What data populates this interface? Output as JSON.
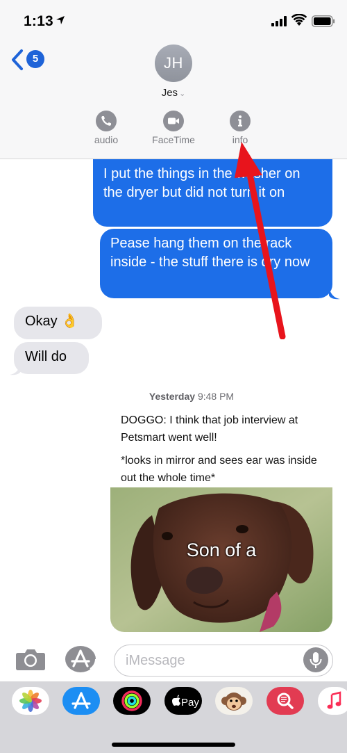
{
  "status_bar": {
    "time": "1:13"
  },
  "header": {
    "back_count": "5",
    "avatar_initials": "JH",
    "contact_name": "Jes",
    "chevron": "⌄",
    "actions": [
      {
        "label": "audio",
        "icon": "phone-icon"
      },
      {
        "label": "FaceTime",
        "icon": "video-camera-icon"
      },
      {
        "label": "info",
        "icon": "info-icon"
      }
    ]
  },
  "messages": {
    "sent": [
      "I put the things in the washer on the dryer but did not turn it on",
      "Pease hang them on the rack inside - the stuff there is dry now"
    ],
    "received": [
      "Okay 👌",
      "Will do"
    ]
  },
  "shared": {
    "day": "Yesterday",
    "time": "9:48 PM",
    "line1": "DOGGO: I think that job interview at Petsmart went well!",
    "line2": "*looks in mirror and sees ear was inside out the whole time*",
    "image_caption": "Son of a"
  },
  "input": {
    "placeholder": "iMessage"
  },
  "drawer_apps": [
    "photos-app-icon",
    "app-store-app-icon",
    "activity-app-icon",
    "apple-pay-app-icon",
    "animoji-app-icon",
    "search-images-app-icon",
    "music-app-icon"
  ],
  "colors": {
    "sent_bubble": "#1d6ee8",
    "received_bubble": "#e6e6eb",
    "annotation_arrow": "#e8141c"
  }
}
